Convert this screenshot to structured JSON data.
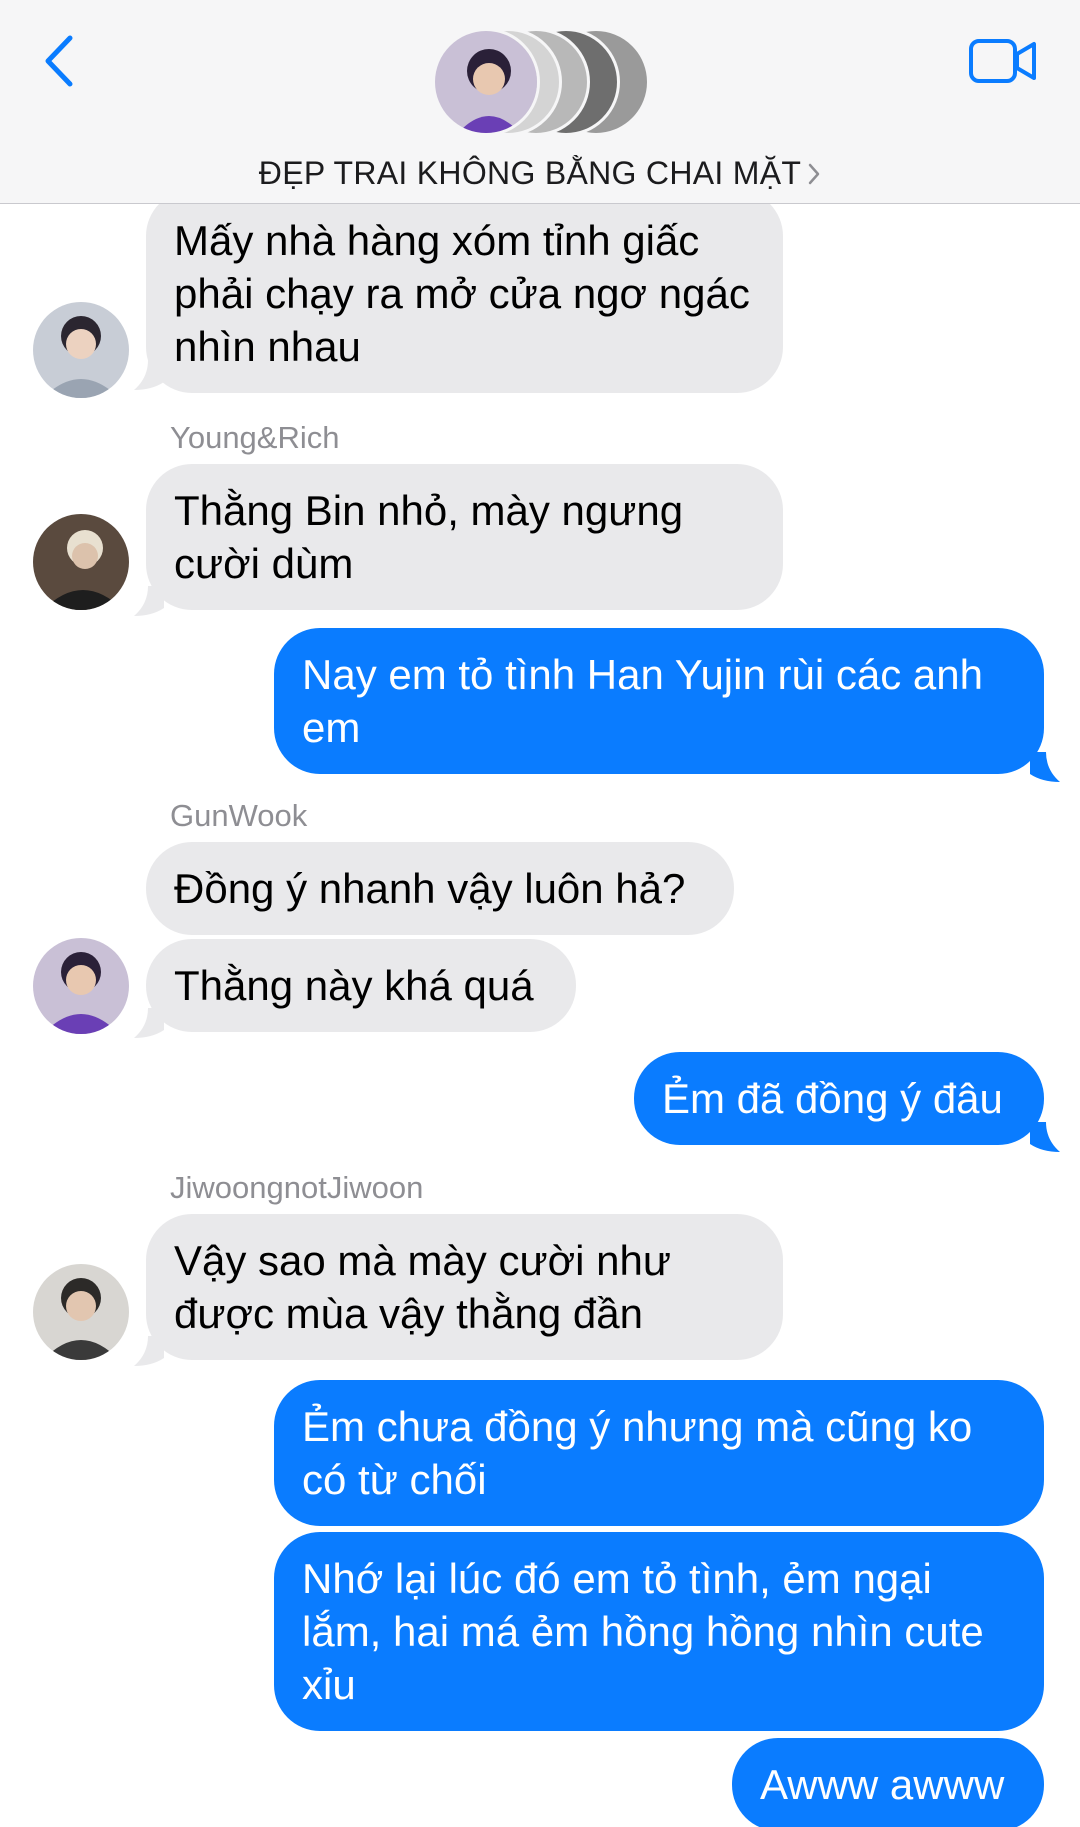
{
  "header": {
    "title": "ĐẸP TRAI KHÔNG BẰNG CHAI MẶT",
    "back_icon": "chevron-left-icon",
    "video_icon": "video-camera-icon",
    "accent_color": "#0a7cff"
  },
  "messages": [
    {
      "direction": "incoming",
      "sender": "",
      "text": "Mấy nhà hàng xóm tỉnh giấc phải chạy ra mở cửa ngơ ngác nhìn nhau"
    },
    {
      "direction": "incoming",
      "sender": "Young&Rich",
      "text": "Thằng Bin nhỏ, mày ngưng cười dùm"
    },
    {
      "direction": "outgoing",
      "sender": "",
      "text": "Nay em tỏ tình Han Yujin rùi các anh em"
    },
    {
      "direction": "incoming",
      "sender": "GunWook",
      "text": "Đồng ý nhanh vậy luôn hả?"
    },
    {
      "direction": "incoming",
      "sender": "",
      "text": "Thằng này khá quá"
    },
    {
      "direction": "outgoing",
      "sender": "",
      "text": "Ẻm đã đồng ý đâu"
    },
    {
      "direction": "incoming",
      "sender": "JiwoongnotJiwoon",
      "text": "Vậy sao mà mày cười như được mùa vậy thằng đần"
    },
    {
      "direction": "outgoing",
      "sender": "",
      "text": "Ẻm chưa đồng ý nhưng mà cũng ko có từ chối"
    },
    {
      "direction": "outgoing",
      "sender": "",
      "text": "Nhớ lại lúc đó em tỏ tình, ẻm ngại lắm, hai má ẻm hồng hồng nhìn cute xỉu"
    },
    {
      "direction": "outgoing",
      "sender": "",
      "text": "Awww awww"
    }
  ],
  "colors": {
    "incoming_bubble": "#e9e9eb",
    "outgoing_bubble": "#0a7cff",
    "sender_label": "#8e8e93"
  }
}
